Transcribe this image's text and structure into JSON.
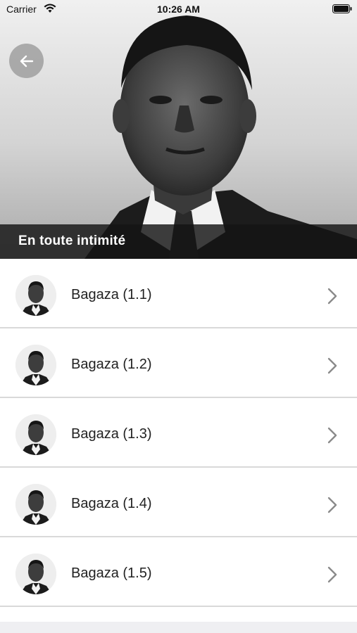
{
  "status_bar": {
    "carrier": "Carrier",
    "time": "10:26 AM"
  },
  "header": {
    "title": "En toute intimité"
  },
  "list": {
    "items": [
      {
        "label": "Bagaza (1.1)"
      },
      {
        "label": "Bagaza (1.2)"
      },
      {
        "label": "Bagaza (1.3)"
      },
      {
        "label": "Bagaza (1.4)"
      },
      {
        "label": "Bagaza (1.5)"
      }
    ]
  },
  "colors": {
    "caption_bg": "#141414",
    "back_button_bg": "#969696",
    "divider": "#d9d9d9"
  },
  "icons": {
    "back": "arrow-left-icon",
    "chevron": "chevron-right-icon",
    "wifi": "wifi-icon",
    "battery": "battery-icon"
  }
}
